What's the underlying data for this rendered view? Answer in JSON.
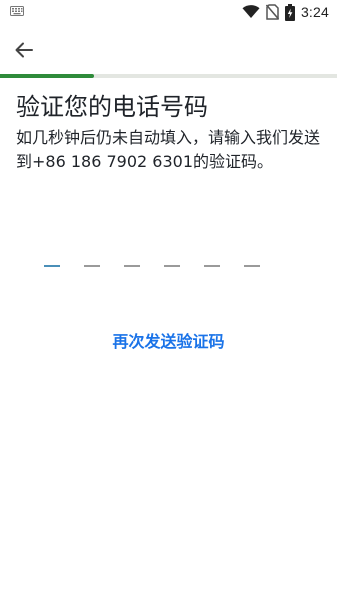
{
  "status_bar": {
    "time": "3:24",
    "icons": [
      "keyboard-icon",
      "wifi-icon",
      "no-sim-icon",
      "battery-charging-icon"
    ]
  },
  "app_bar": {
    "back_icon": "arrow-left-icon"
  },
  "progress": {
    "fraction": 0.28,
    "color": "#2e8b3a",
    "track_color": "#e3e6e1"
  },
  "content": {
    "title": "验证您的电话号码",
    "subtitle": "如几秒钟后仍未自动填入，请输入我们发送到+86 186 7902 6301的验证码。"
  },
  "otp": {
    "length": 6,
    "active_index": 0,
    "active_color": "#4a8fb8",
    "slot_color": "#9a9a9a"
  },
  "resend": {
    "label": "再次发送验证码",
    "color": "#1a73e8"
  }
}
